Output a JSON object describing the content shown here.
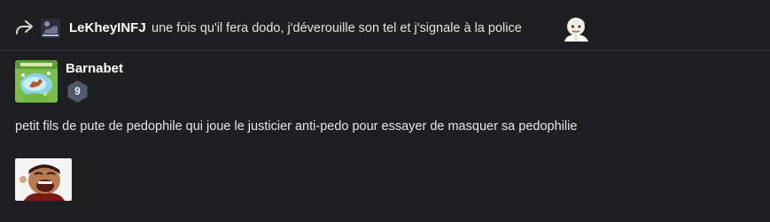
{
  "reply": {
    "author": "LeKheyINFJ",
    "text": "une fois qu'il fera dodo, j'déverouille son tel et j'signale à la police",
    "icons": {
      "reply": "share-forward-icon",
      "avatar": "user-avatar",
      "emoji": "sticker-emoji"
    }
  },
  "post": {
    "author": "Barnabet",
    "badge": "9",
    "body": "petit fils de pute de pedophile qui joue le justicier anti-pedo pour essayer de masquer sa pedophilie",
    "sticker": "laughing-sticker"
  },
  "colors": {
    "background": "#1f1f21",
    "divider": "#333338",
    "badge": "#4f5a6b",
    "text": "#e6e6e6"
  }
}
